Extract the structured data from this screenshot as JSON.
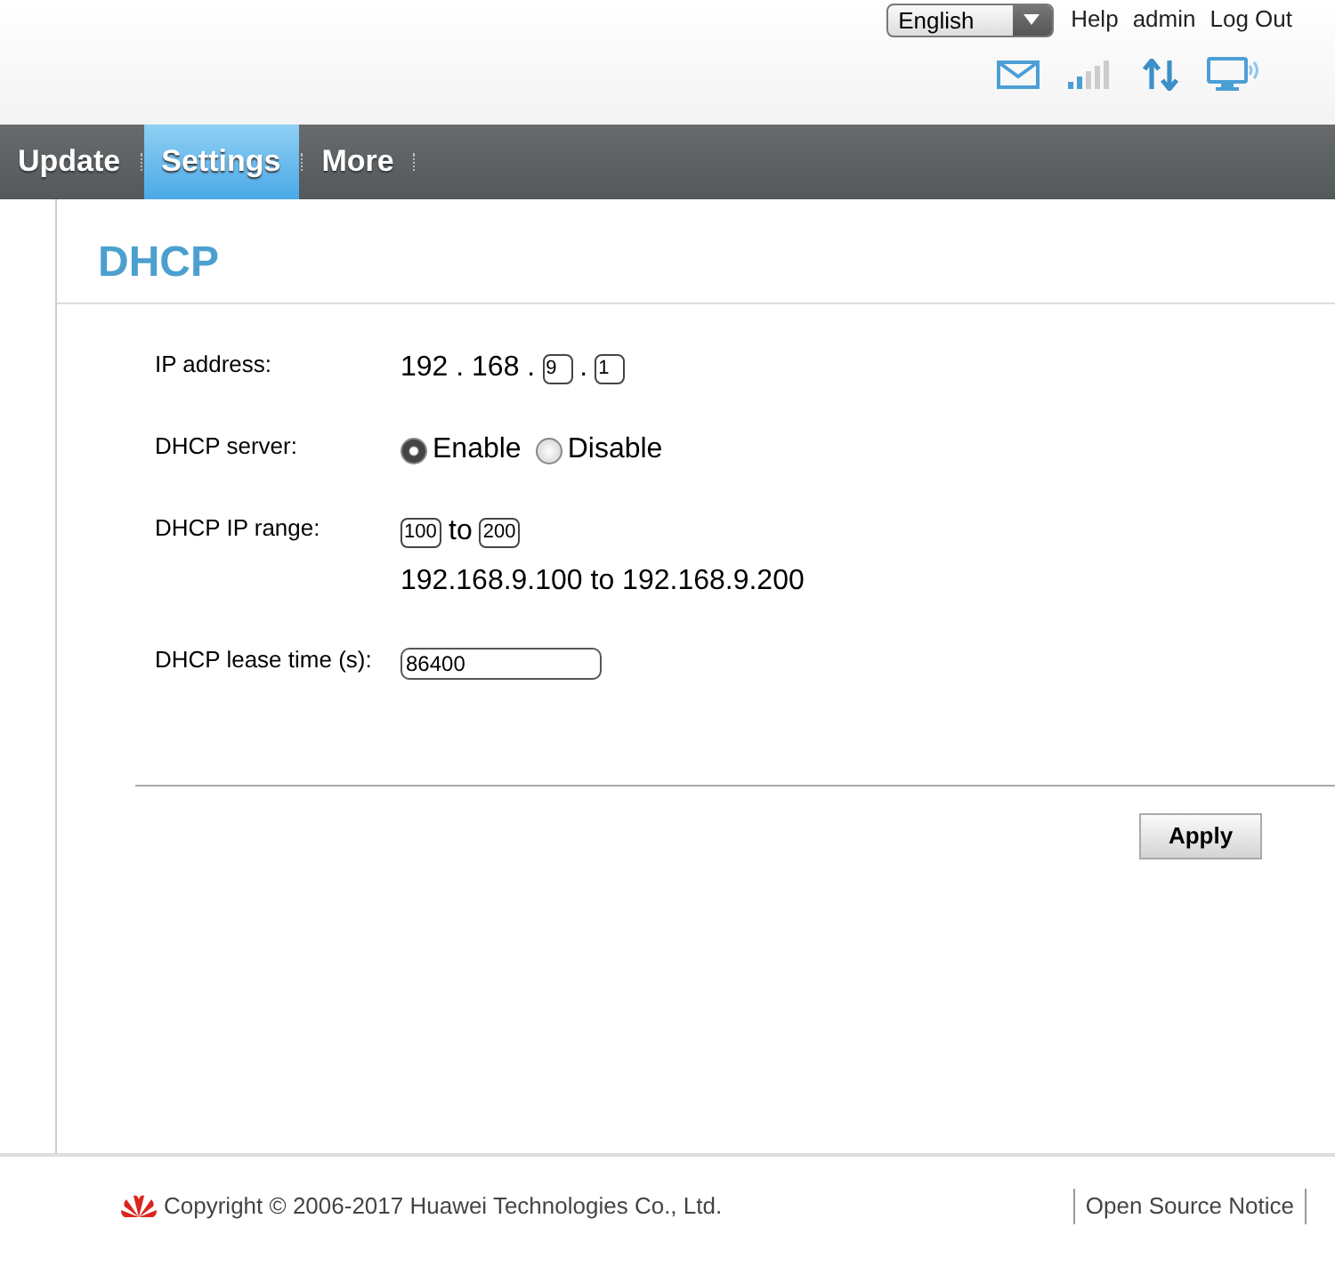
{
  "header": {
    "language": "English",
    "links": [
      "Help",
      "admin",
      "Log Out"
    ]
  },
  "nav": [
    {
      "label": "Update",
      "selected": false
    },
    {
      "label": "Settings",
      "selected": true
    },
    {
      "label": "More",
      "selected": false
    }
  ],
  "page_title": "DHCP",
  "form": [
    {
      "kind": "ip",
      "label": "IP address:",
      "segments": [
        {
          "kind": "text",
          "text": "192 . 168 ."
        },
        {
          "kind": "field",
          "value": "9"
        },
        {
          "kind": "text",
          "text": "."
        },
        {
          "kind": "field",
          "value": "1"
        }
      ]
    },
    {
      "kind": "radio",
      "label": "DHCP server:",
      "options": [
        {
          "label": "Enable",
          "selected": true
        },
        {
          "label": "Disable",
          "selected": false
        }
      ]
    },
    {
      "kind": "range",
      "label": "DHCP IP range:",
      "start": "100",
      "joiner": "to",
      "end": "200",
      "summary": "192.168.9.100 to 192.168.9.200"
    },
    {
      "kind": "text",
      "label": "DHCP lease time (s):",
      "value": "86400"
    }
  ],
  "apply_button": "Apply",
  "footer": {
    "copyright": "Copyright © 2006-2017 Huawei Technologies Co., Ltd.",
    "link": "Open Source Notice"
  }
}
